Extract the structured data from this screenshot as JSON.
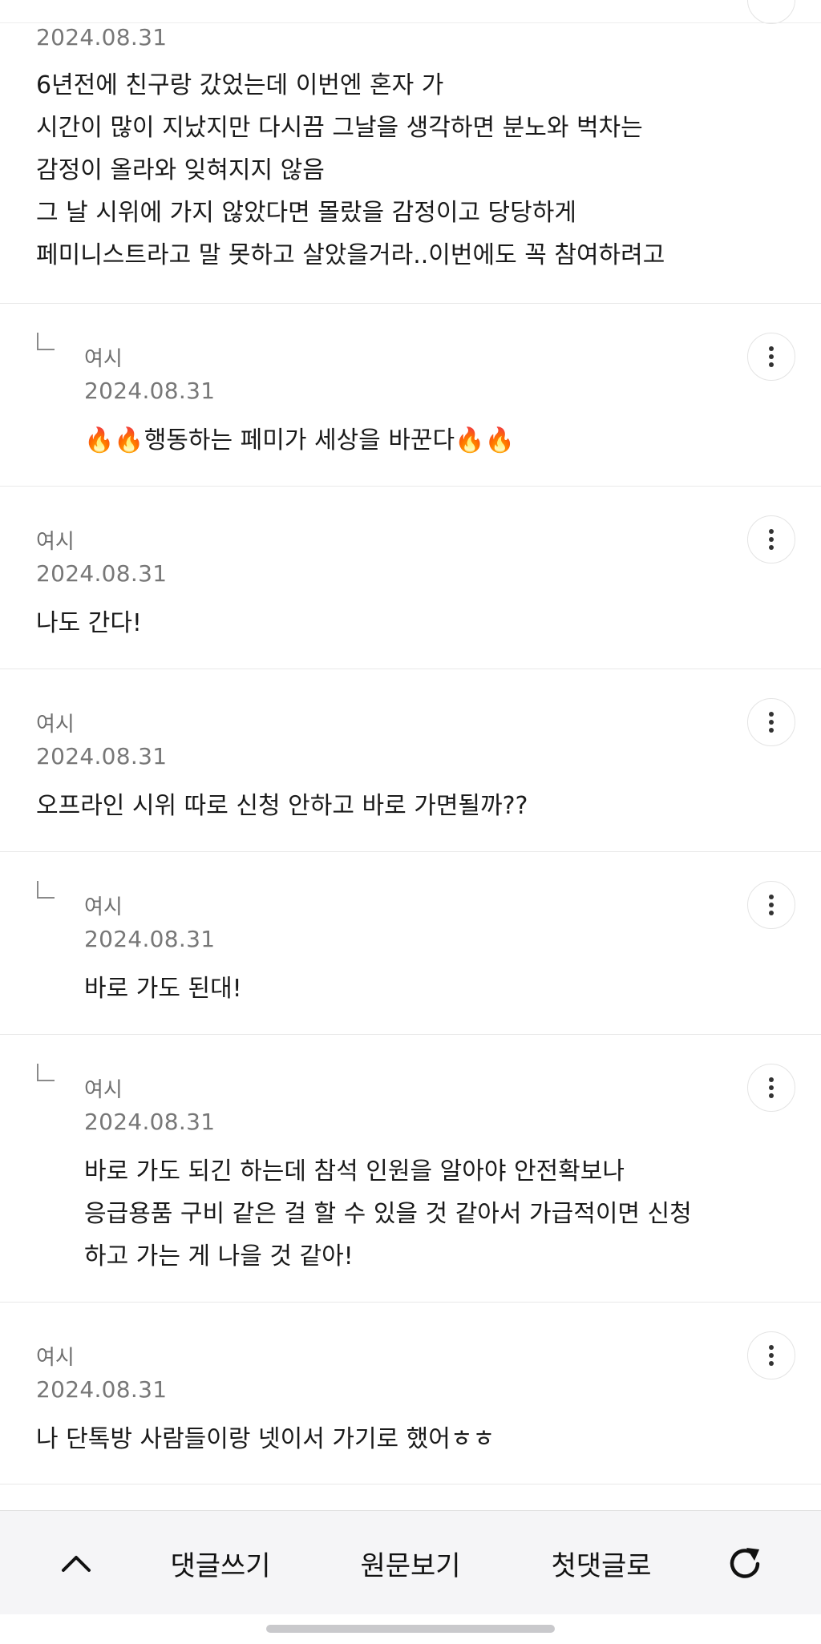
{
  "comments": [
    {
      "date": "2024.08.31",
      "lines": [
        "6년전에 친구랑 갔었는데 이번엔 혼자 가",
        "시간이 많이 지났지만 다시끔 그날을 생각하면 분노와 벅차는",
        "감정이 올라와 잊혀지지 않음",
        "그 날 시위에 가지 않았다면 몰랐을 감정이고 당당하게",
        "페미니스트라고 말 못하고 살았을거라..이번에도 꼭 참여하려고"
      ]
    },
    {
      "author": "여시",
      "date": "2024.08.31",
      "reply": true,
      "lines": [
        "🔥🔥행동하는 페미가 세상을 바꾼다🔥🔥"
      ]
    },
    {
      "author": "여시",
      "date": "2024.08.31",
      "reply": false,
      "lines": [
        "나도 간다!"
      ]
    },
    {
      "author": "여시",
      "date": "2024.08.31",
      "reply": false,
      "lines": [
        "오프라인 시위 따로 신청 안하고 바로 가면될까??"
      ]
    },
    {
      "author": "여시",
      "date": "2024.08.31",
      "reply": true,
      "lines": [
        "바로 가도 된대!"
      ]
    },
    {
      "author": "여시",
      "date": "2024.08.31",
      "reply": true,
      "lines": [
        "바로 가도 되긴 하는데 참석 인원을 알아야 안전확보나",
        "응급용품 구비 같은 걸 할 수 있을 것 같아서 가급적이면 신청",
        "하고 가는 게 나을 것 같아!"
      ]
    },
    {
      "author": "여시",
      "date": "2024.08.31",
      "reply": false,
      "lines": [
        "나 단톡방 사람들이랑 넷이서 가기로 했어ㅎㅎ"
      ]
    }
  ],
  "toolbar": {
    "up_icon": "chevron-up-icon",
    "write_label": "댓글쓰기",
    "original_label": "원문보기",
    "first_label": "첫댓글로",
    "refresh_icon": "refresh-icon"
  }
}
